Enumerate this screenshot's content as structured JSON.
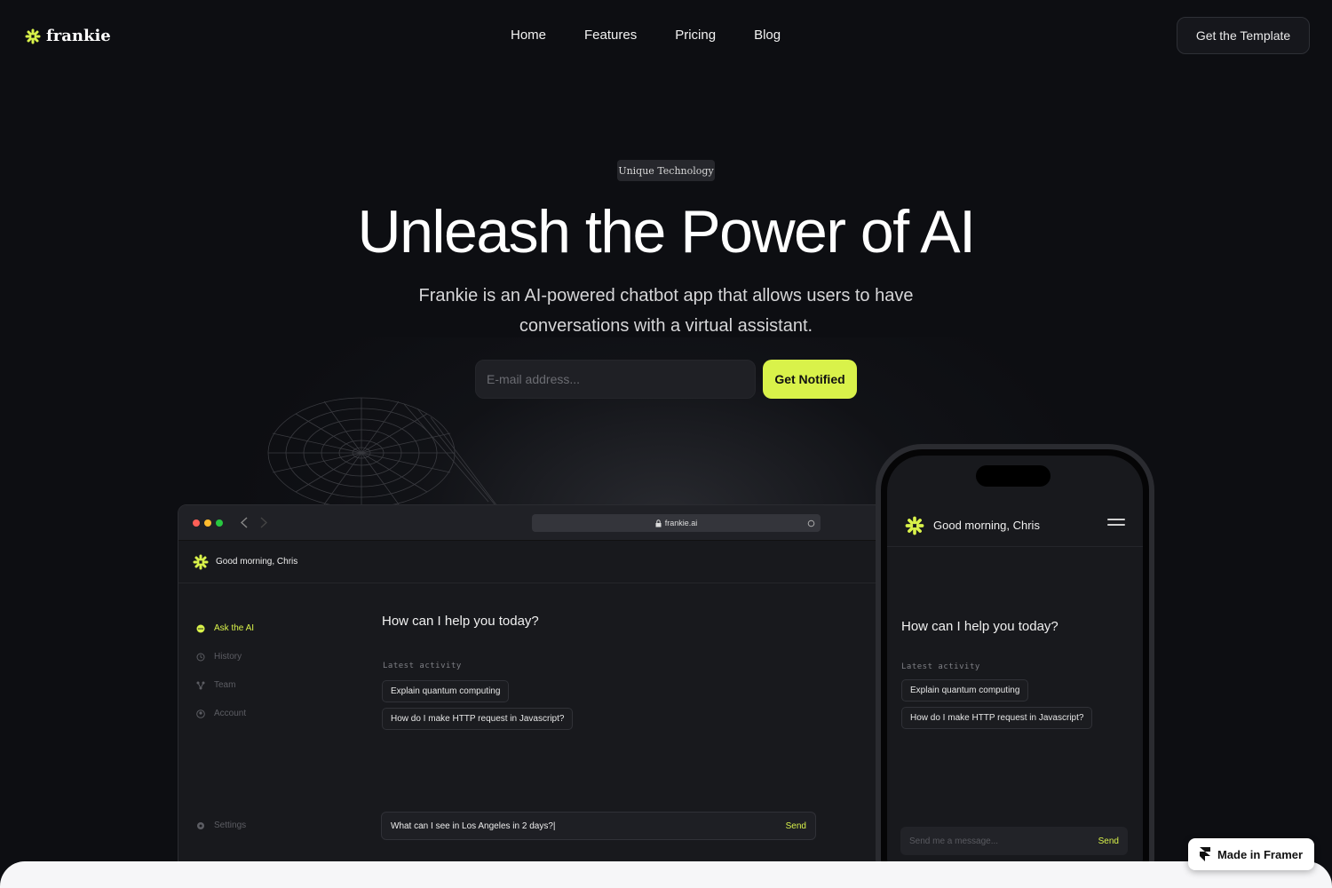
{
  "brand": {
    "name": "frankie",
    "accent": "#d9f24a",
    "logo_icon": "asterisk-flower-icon"
  },
  "nav": {
    "items": [
      "Home",
      "Features",
      "Pricing",
      "Blog"
    ],
    "cta": "Get the Template"
  },
  "hero": {
    "badge": "Unique Technology",
    "title": "Unleash the Power of AI",
    "subtitle": "Frankie is an AI-powered chatbot app that allows users to have conversations with a virtual assistant.",
    "email_placeholder": "E-mail address...",
    "notify_label": "Get Notified"
  },
  "browser": {
    "url": "frankie.ai",
    "greeting": "Good morning, Chris",
    "sidebar": [
      {
        "label": "Ask the AI",
        "icon": "chat-icon",
        "active": true
      },
      {
        "label": "History",
        "icon": "history-icon",
        "active": false
      },
      {
        "label": "Team",
        "icon": "team-icon",
        "active": false
      },
      {
        "label": "Account",
        "icon": "account-icon",
        "active": false
      }
    ],
    "settings_label": "Settings",
    "question": "How can I help you today?",
    "latest_label": "Latest activity",
    "activity": [
      "Explain quantum computing",
      "How do I make HTTP request in Javascript?"
    ],
    "input_value": "What can I see in Los Angeles in 2 days?|",
    "send_label": "Send"
  },
  "phone": {
    "greeting": "Good morning, Chris",
    "question": "How can I help you today?",
    "latest_label": "Latest activity",
    "activity": [
      "Explain quantum computing",
      "How do I make HTTP request in Javascript?"
    ],
    "input_placeholder": "Send me a message...",
    "send_label": "Send"
  },
  "badge_framer": "Made in Framer"
}
